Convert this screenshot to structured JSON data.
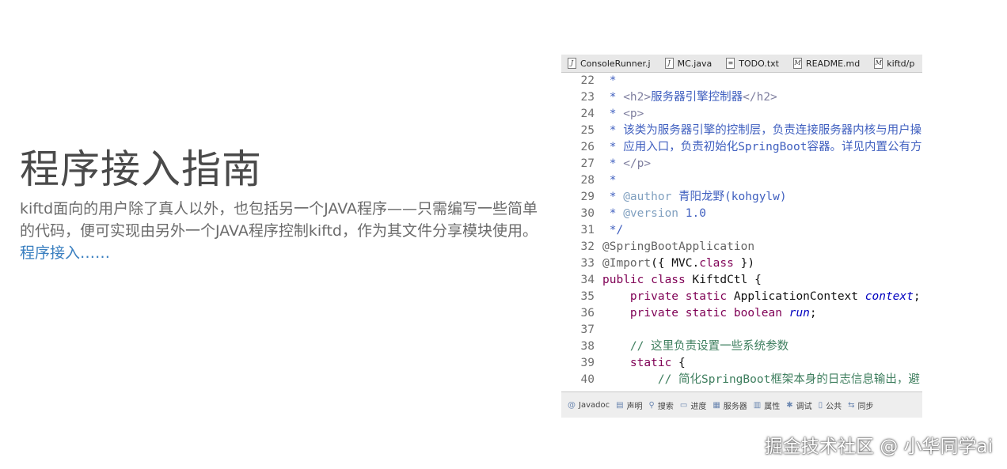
{
  "intro": {
    "title": "程序接入指南",
    "description": "kiftd面向的用户除了真人以外，也包括另一个JAVA程序——只需编写一些简单的代码，便可实现由另外一个JAVA程序控制kiftd，作为其文件分享模块使用。",
    "link_label": "程序接入……"
  },
  "editor": {
    "tabs": [
      {
        "label": "ConsoleRunner.j",
        "icon": "java-file-icon"
      },
      {
        "label": "MC.java",
        "icon": "java-file-icon"
      },
      {
        "label": "TODO.txt",
        "icon": "text-file-icon"
      },
      {
        "label": "README.md",
        "icon": "markdown-file-icon"
      },
      {
        "label": "kiftd/p",
        "icon": "markdown-file-icon"
      }
    ],
    "lines": [
      {
        "num": "22",
        "parts": [
          {
            "t": " * ",
            "c": "c-doc"
          }
        ]
      },
      {
        "num": "23",
        "parts": [
          {
            "t": " * ",
            "c": "c-doc"
          },
          {
            "t": "<h2>",
            "c": "c-tag"
          },
          {
            "t": "服务器引擎控制器",
            "c": "c-doc"
          },
          {
            "t": "</h2>",
            "c": "c-tag"
          }
        ]
      },
      {
        "num": "24",
        "parts": [
          {
            "t": " * ",
            "c": "c-doc"
          },
          {
            "t": "<p>",
            "c": "c-tag"
          }
        ]
      },
      {
        "num": "25",
        "parts": [
          {
            "t": " * 该类为服务器引擎的控制层，负责连接服务器内核与用户操",
            "c": "c-doc"
          }
        ]
      },
      {
        "num": "26",
        "parts": [
          {
            "t": " * 应用入口，负责初始化SpringBoot容器。详见内置公有方",
            "c": "c-doc"
          }
        ]
      },
      {
        "num": "27",
        "parts": [
          {
            "t": " * ",
            "c": "c-doc"
          },
          {
            "t": "</p>",
            "c": "c-tag"
          }
        ]
      },
      {
        "num": "28",
        "parts": [
          {
            "t": " *",
            "c": "c-doc"
          }
        ]
      },
      {
        "num": "29",
        "parts": [
          {
            "t": " * ",
            "c": "c-doc"
          },
          {
            "t": "@author",
            "c": "c-taglbl"
          },
          {
            "t": " 青阳龙野(kohgylw)",
            "c": "c-doc"
          }
        ]
      },
      {
        "num": "30",
        "parts": [
          {
            "t": " * ",
            "c": "c-doc"
          },
          {
            "t": "@version",
            "c": "c-taglbl"
          },
          {
            "t": " 1.0",
            "c": "c-doc"
          }
        ]
      },
      {
        "num": "31",
        "parts": [
          {
            "t": " */",
            "c": "c-doc"
          }
        ]
      },
      {
        "num": "32",
        "parts": [
          {
            "t": "@SpringBootApplication",
            "c": "c-ann"
          }
        ]
      },
      {
        "num": "33",
        "parts": [
          {
            "t": "@Import",
            "c": "c-ann"
          },
          {
            "t": "({ MVC.",
            "c": ""
          },
          {
            "t": "class",
            "c": "c-kw"
          },
          {
            "t": " })",
            "c": ""
          }
        ]
      },
      {
        "num": "34",
        "parts": [
          {
            "t": "public class",
            "c": "c-kw"
          },
          {
            "t": " KiftdCtl {",
            "c": ""
          }
        ]
      },
      {
        "num": "35",
        "parts": [
          {
            "t": "    ",
            "c": ""
          },
          {
            "t": "private static",
            "c": "c-kw"
          },
          {
            "t": " ApplicationContext ",
            "c": ""
          },
          {
            "t": "context",
            "c": "c-fld"
          },
          {
            "t": ";",
            "c": ""
          }
        ]
      },
      {
        "num": "36",
        "parts": [
          {
            "t": "    ",
            "c": ""
          },
          {
            "t": "private static boolean",
            "c": "c-kw"
          },
          {
            "t": " ",
            "c": ""
          },
          {
            "t": "run",
            "c": "c-fld"
          },
          {
            "t": ";",
            "c": ""
          }
        ]
      },
      {
        "num": "37",
        "parts": [
          {
            "t": "",
            "c": ""
          }
        ]
      },
      {
        "num": "38",
        "parts": [
          {
            "t": "    ",
            "c": ""
          },
          {
            "t": "// 这里负责设置一些系统参数",
            "c": "c-cmt"
          }
        ]
      },
      {
        "num": "39",
        "parts": [
          {
            "t": "    ",
            "c": ""
          },
          {
            "t": "static",
            "c": "c-kw"
          },
          {
            "t": " {",
            "c": ""
          }
        ]
      },
      {
        "num": "40",
        "parts": [
          {
            "t": "        ",
            "c": ""
          },
          {
            "t": "// 简化SpringBoot框架本身的日志信息输出，避",
            "c": "c-cmt"
          }
        ]
      }
    ],
    "status_items": [
      {
        "label": "Javadoc",
        "icon": "at-icon"
      },
      {
        "label": "声明",
        "icon": "declaration-icon"
      },
      {
        "label": "搜索",
        "icon": "search-icon"
      },
      {
        "label": "进度",
        "icon": "progress-icon"
      },
      {
        "label": "服务器",
        "icon": "server-icon"
      },
      {
        "label": "属性",
        "icon": "properties-icon"
      },
      {
        "label": "调试",
        "icon": "debug-icon"
      },
      {
        "label": "公共",
        "icon": "console-icon"
      },
      {
        "label": "同步",
        "icon": "sync-icon"
      }
    ]
  },
  "watermark": "掘金技术社区 @ 小华同学ai"
}
